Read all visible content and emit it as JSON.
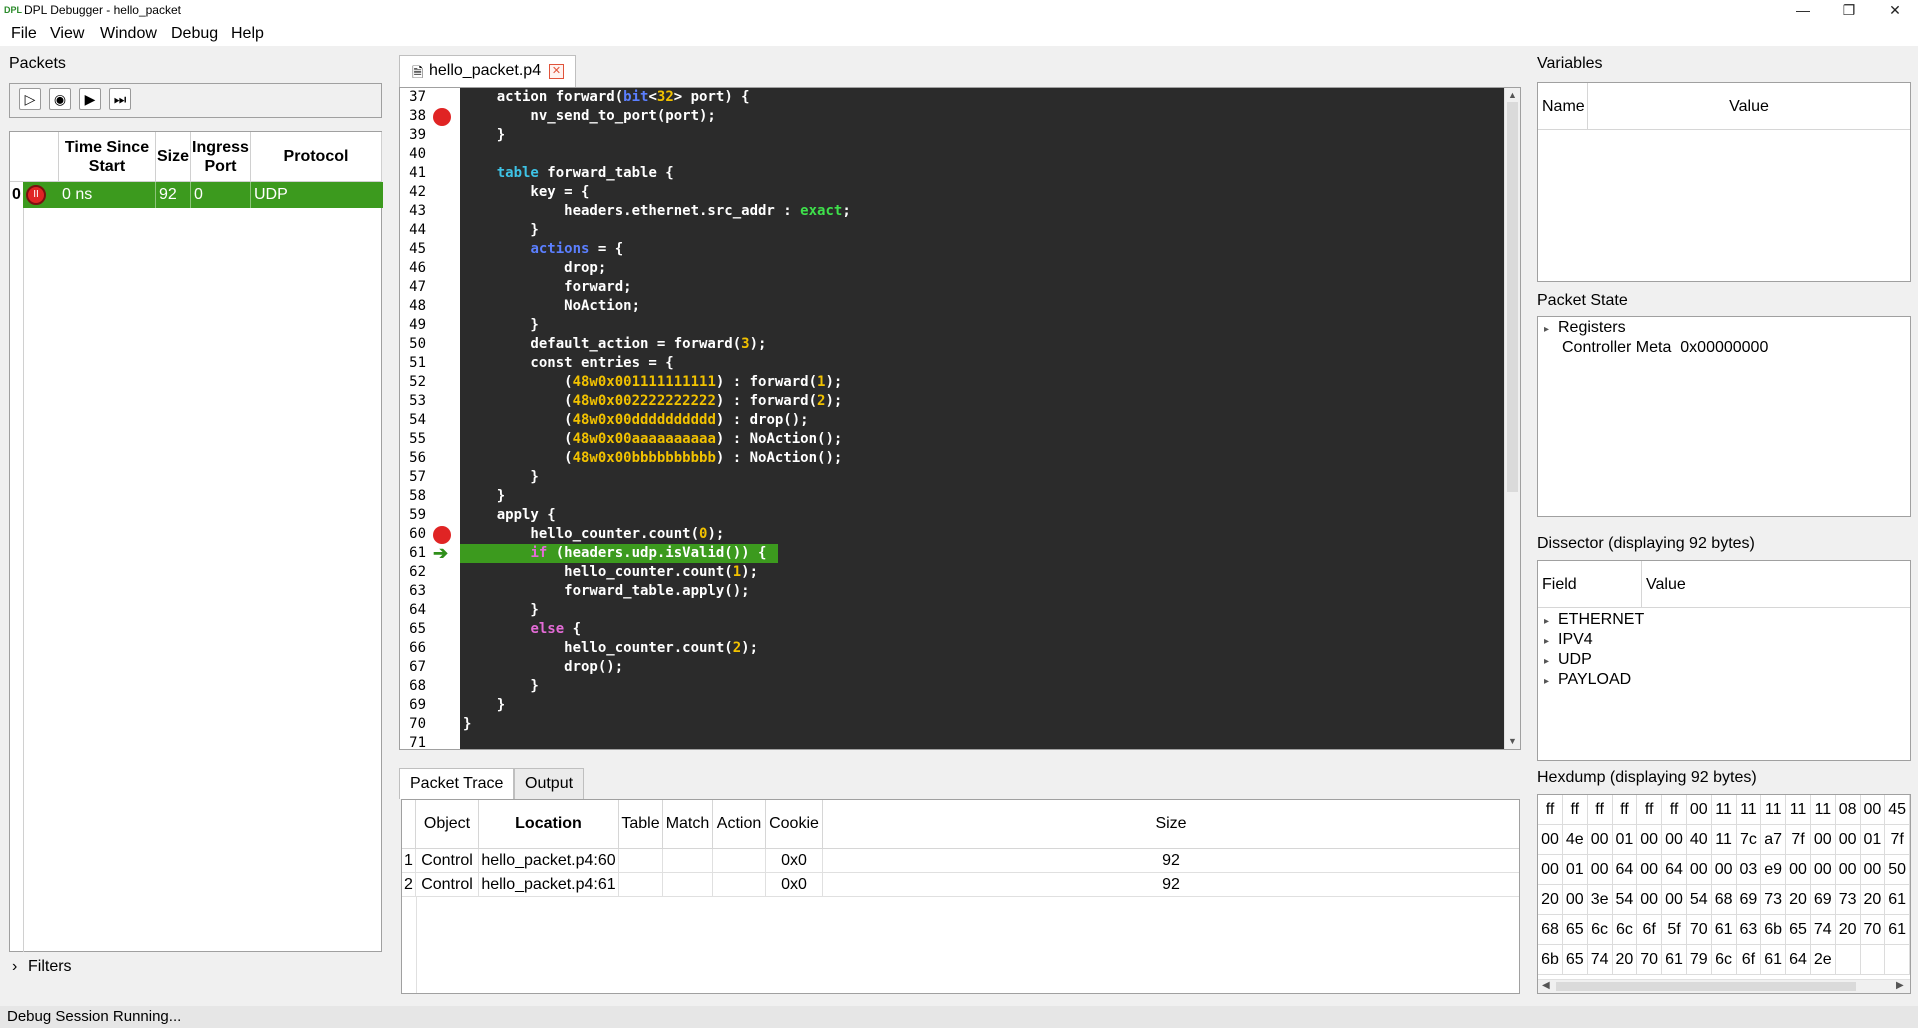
{
  "window": {
    "title": "DPL Debugger - hello_packet",
    "logo": "DPL"
  },
  "menu": [
    "File",
    "View",
    "Window",
    "Debug",
    "Help"
  ],
  "packets": {
    "title": "Packets",
    "columns": [
      "Time Since Start",
      "Size",
      "Ingress Port",
      "Protocol"
    ],
    "rows": [
      {
        "index": "0",
        "time": "0 ns",
        "size": "92",
        "port": "0",
        "protocol": "UDP"
      }
    ],
    "filters_label": "Filters"
  },
  "editor": {
    "tab": "hello_packet.p4",
    "breakpoints": [
      "38",
      "60"
    ],
    "current_line": "61",
    "lines": [
      {
        "n": "37",
        "html": "    action forward(<span class='kb'>bit</span>&lt;<span class='num'>32</span>&gt; port) {"
      },
      {
        "n": "38",
        "html": "        nv_send_to_port(port);"
      },
      {
        "n": "39",
        "html": "    }"
      },
      {
        "n": "40",
        "html": ""
      },
      {
        "n": "41",
        "html": "    <span class='kw'>table</span> forward_table {"
      },
      {
        "n": "42",
        "html": "        key = {"
      },
      {
        "n": "43",
        "html": "            headers.ethernet.src_addr : <span class='ex'>exact</span>;"
      },
      {
        "n": "44",
        "html": "        }"
      },
      {
        "n": "45",
        "html": "        <span class='kb'>actions</span> = {"
      },
      {
        "n": "46",
        "html": "            drop;"
      },
      {
        "n": "47",
        "html": "            forward;"
      },
      {
        "n": "48",
        "html": "            NoAction;"
      },
      {
        "n": "49",
        "html": "        }"
      },
      {
        "n": "50",
        "html": "        default_action = forward(<span class='num'>3</span>);"
      },
      {
        "n": "51",
        "html": "        const entries = {"
      },
      {
        "n": "52",
        "html": "            (<span class='num'>48w0x001111111111</span>) : forward(<span class='num'>1</span>);"
      },
      {
        "n": "53",
        "html": "            (<span class='num'>48w0x002222222222</span>) : forward(<span class='num'>2</span>);"
      },
      {
        "n": "54",
        "html": "            (<span class='num'>48w0x00dddddddddd</span>) : drop();"
      },
      {
        "n": "55",
        "html": "            (<span class='num'>48w0x00aaaaaaaaaa</span>) : NoAction();"
      },
      {
        "n": "56",
        "html": "            (<span class='num'>48w0x00bbbbbbbbbb</span>) : NoAction();"
      },
      {
        "n": "57",
        "html": "        }"
      },
      {
        "n": "58",
        "html": "    }"
      },
      {
        "n": "59",
        "html": "    apply {"
      },
      {
        "n": "60",
        "html": "        hello_counter.count(<span class='num'>0</span>);"
      },
      {
        "n": "61",
        "html": "        <span class='kp'>if</span> (headers.udp.isValid()) {"
      },
      {
        "n": "62",
        "html": "            hello_counter.count(<span class='num'>1</span>);"
      },
      {
        "n": "63",
        "html": "            forward_table.apply();"
      },
      {
        "n": "64",
        "html": "        }"
      },
      {
        "n": "65",
        "html": "        <span class='kp'>else</span> {"
      },
      {
        "n": "66",
        "html": "            hello_counter.count(<span class='num'>2</span>);"
      },
      {
        "n": "67",
        "html": "            drop();"
      },
      {
        "n": "68",
        "html": "        }"
      },
      {
        "n": "69",
        "html": "    }"
      },
      {
        "n": "70",
        "html": "}"
      },
      {
        "n": "71",
        "html": ""
      }
    ]
  },
  "trace": {
    "tabs": [
      "Packet Trace",
      "Output"
    ],
    "columns": [
      "Object",
      "Location",
      "Table",
      "Match",
      "Action",
      "Cookie",
      "Size"
    ],
    "rows": [
      {
        "n": "1",
        "object": "Control",
        "location": "hello_packet.p4:60",
        "table": "",
        "match": "",
        "action": "",
        "cookie": "0x0",
        "size": "92"
      },
      {
        "n": "2",
        "object": "Control",
        "location": "hello_packet.p4:61",
        "table": "",
        "match": "",
        "action": "",
        "cookie": "0x0",
        "size": "92"
      }
    ]
  },
  "variables": {
    "title": "Variables",
    "columns": [
      "Name",
      "Value"
    ]
  },
  "packet_state": {
    "title": "Packet State",
    "registers": "Registers",
    "controller_meta": "Controller Meta  0x00000000"
  },
  "dissector": {
    "title": "Dissector (displaying 92 bytes)",
    "columns": [
      "Field",
      "Value"
    ],
    "items": [
      "ETHERNET",
      "IPV4",
      "UDP",
      "PAYLOAD"
    ]
  },
  "hexdump": {
    "title": "Hexdump (displaying 92 bytes)",
    "rows": [
      [
        "ff",
        "ff",
        "ff",
        "ff",
        "ff",
        "ff",
        "00",
        "11",
        "11",
        "11",
        "11",
        "11",
        "08",
        "00",
        "45"
      ],
      [
        "00",
        "4e",
        "00",
        "01",
        "00",
        "00",
        "40",
        "11",
        "7c",
        "a7",
        "7f",
        "00",
        "00",
        "01",
        "7f"
      ],
      [
        "00",
        "01",
        "00",
        "64",
        "00",
        "64",
        "00",
        "00",
        "03",
        "e9",
        "00",
        "00",
        "00",
        "00",
        "50"
      ],
      [
        "20",
        "00",
        "3e",
        "54",
        "00",
        "00",
        "54",
        "68",
        "69",
        "73",
        "20",
        "69",
        "73",
        "20",
        "61"
      ],
      [
        "68",
        "65",
        "6c",
        "6c",
        "6f",
        "5f",
        "70",
        "61",
        "63",
        "6b",
        "65",
        "74",
        "20",
        "70",
        "61"
      ],
      [
        "6b",
        "65",
        "74",
        "20",
        "70",
        "61",
        "79",
        "6c",
        "6f",
        "61",
        "64",
        "2e",
        "",
        "",
        ""
      ]
    ]
  },
  "status": "Debug Session Running..."
}
